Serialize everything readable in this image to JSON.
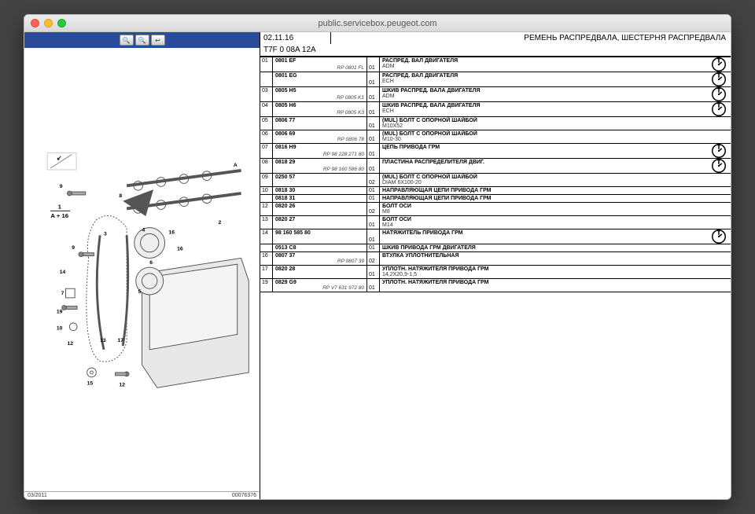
{
  "window": {
    "title": "public.servicebox.peugeot.com"
  },
  "toolbar": {
    "btn1": "🔍",
    "btn2": "🔍",
    "btn3": "↩"
  },
  "diagram": {
    "date": "03/2011",
    "code": "00076376",
    "frac": "1",
    "frac_label": "A + 16"
  },
  "header": {
    "topcode": "02.11.16",
    "title": "РЕМЕНЬ РАСПРЕДВАЛА, ШЕСТЕРНЯ РАСПРЕДВАЛА",
    "vin": "T7F 0 08A 12A"
  },
  "parts": [
    {
      "n": "01",
      "ref": "0801 EF",
      "rp": "RP 0801 FL",
      "q": "01",
      "name": "РАСПРЕД. ВАЛ ДВИГАТЕЛЯ",
      "spec": "ADM",
      "stop": true
    },
    {
      "n": "",
      "ref": "0801 EG",
      "rp": "",
      "q": "01",
      "name": "РАСПРЕД. ВАЛ ДВИГАТЕЛЯ",
      "spec": "ECH",
      "stop": true
    },
    {
      "n": "03",
      "ref": "0805 H5",
      "rp": "RP 0805 K1",
      "q": "01",
      "name": "ШКИВ РАСПРЕД. ВАЛА ДВИГАТЕЛЯ",
      "spec": "ADM",
      "stop": true
    },
    {
      "n": "04",
      "ref": "0805 H6",
      "rp": "RP 0805 K3",
      "q": "01",
      "name": "ШКИВ РАСПРЕД. ВАЛА ДВИГАТЕЛЯ",
      "spec": "ECH",
      "stop": true
    },
    {
      "n": "05",
      "ref": "0806 77",
      "rp": "",
      "q": "01",
      "name": "(MUL) БОЛТ С ОПОРНОЙ ШАЙБОЙ",
      "spec": "M10X52",
      "stop": false
    },
    {
      "n": "06",
      "ref": "0806 69",
      "rp": "RP 0806 78",
      "q": "01",
      "name": "(MUL) БОЛТ С ОПОРНОЙ ШАЙБОЙ",
      "spec": "M10-30",
      "stop": false
    },
    {
      "n": "07",
      "ref": "0816 H9",
      "rp": "RP 98 228 271 80",
      "q": "01",
      "name": "ЦЕПЬ ПРИВОДА ГРМ",
      "spec": "",
      "stop": true
    },
    {
      "n": "08",
      "ref": "0818 29",
      "rp": "RP 98 160 586 80",
      "q": "01",
      "name": "ПЛАСТИНА РАСПРЕДЕЛИТЕЛЯ ДВИГ.",
      "spec": "",
      "stop": true
    },
    {
      "n": "09",
      "ref": "0250 57",
      "rp": "",
      "q": "02",
      "name": "(MUL) БОЛТ С ОПОРНОЙ ШАЙБОЙ",
      "spec": "DIAM 6X100-20",
      "stop": false
    },
    {
      "n": "10",
      "ref": "0818 30",
      "rp": "",
      "q": "01",
      "name": "НАПРАВЛЯЮЩАЯ ЦЕПИ ПРИВОДА ГРМ",
      "spec": "",
      "stop": false
    },
    {
      "n": "",
      "ref": "0818 31",
      "rp": "",
      "q": "01",
      "name": "НАПРАВЛЯЮЩАЯ ЦЕПИ ПРИВОДА ГРМ",
      "spec": "",
      "stop": false
    },
    {
      "n": "12",
      "ref": "0820 26",
      "rp": "",
      "q": "02",
      "name": "БОЛТ ОСИ",
      "spec": "M8",
      "stop": false
    },
    {
      "n": "13",
      "ref": "0820 27",
      "rp": "",
      "q": "01",
      "name": "БОЛТ ОСИ",
      "spec": "M14",
      "stop": false
    },
    {
      "n": "14",
      "ref": "98 160 585 80",
      "rp": "",
      "q": "01",
      "name": "НАТЯЖИТЕЛЬ ПРИВОДА ГРМ",
      "spec": "",
      "stop": true
    },
    {
      "n": "",
      "ref": "0513 C8",
      "rp": "",
      "q": "01",
      "name": "ШКИВ ПРИВОДА ГРМ ДВИГАТЕЛЯ",
      "spec": "",
      "stop": false
    },
    {
      "n": "16",
      "ref": "0807 37",
      "rp": "RP 0807 39",
      "q": "02",
      "name": "ВТУЛКА УПЛОТНИТЕЛЬНАЯ",
      "spec": "",
      "stop": false
    },
    {
      "n": "17",
      "ref": "0820 28",
      "rp": "",
      "q": "01",
      "name": "УПЛОТН. НАТЯЖИТЕЛЯ ПРИВОДА ГРМ",
      "spec": "14,2X20,9-1,5",
      "stop": false
    },
    {
      "n": "19",
      "ref": "0829 G9",
      "rp": "RP V7 631 972 80",
      "q": "01",
      "name": "УПЛОТН. НАТЯЖИТЕЛЯ ПРИВОДА ГРМ",
      "spec": "",
      "stop": false
    }
  ]
}
